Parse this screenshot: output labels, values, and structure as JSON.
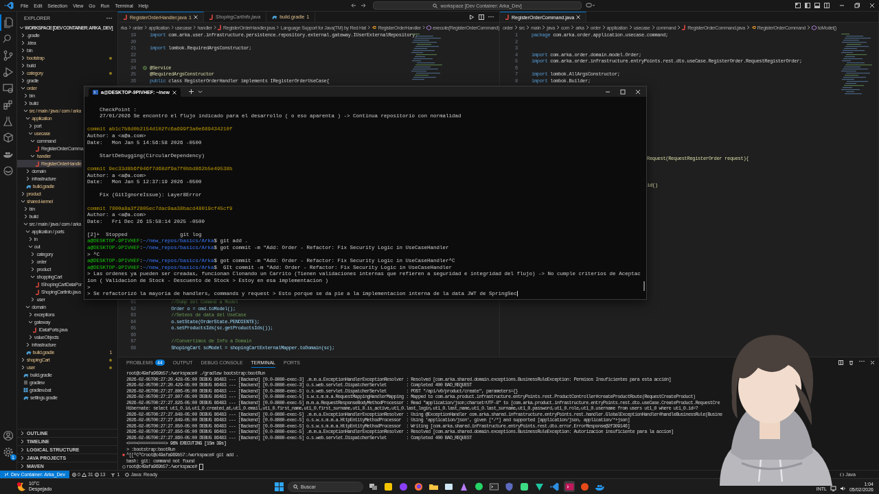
{
  "titlebar": {
    "menu": [
      "File",
      "Edit",
      "Selection",
      "View",
      "Go",
      "Run",
      "Terminal",
      "Help"
    ],
    "search": "workspace [Dev Container: Arka_Dev]"
  },
  "activity_bar": {
    "settings_badge": "1"
  },
  "sidebar": {
    "title": "EXPLORER",
    "workspace": "WORKSPACE [DEV CONTAINER: ARKA_DEV]",
    "tree": [
      {
        "label": ".gradle",
        "kind": "folder",
        "expanded": false,
        "modified": false,
        "dot": false,
        "selected": false
      },
      {
        "label": ".idea",
        "kind": "folder",
        "expanded": false,
        "modified": false,
        "dot": false,
        "selected": false
      },
      {
        "label": "bin",
        "kind": "folder",
        "expanded": false,
        "modified": false,
        "dot": false,
        "selected": false
      },
      {
        "label": "bootstrap",
        "kind": "folder",
        "expanded": false,
        "modified": true,
        "dot": true,
        "selected": false
      },
      {
        "label": "build",
        "kind": "folder",
        "expanded": false,
        "modified": false,
        "dot": false,
        "selected": false
      },
      {
        "label": "category",
        "kind": "folder",
        "expanded": false,
        "modified": true,
        "dot": true,
        "selected": false
      },
      {
        "label": "gradle",
        "kind": "folder",
        "expanded": false,
        "modified": false,
        "dot": false,
        "selected": false
      },
      {
        "label": "order",
        "kind": "folder",
        "expanded": true,
        "modified": true,
        "selected": false,
        "children": [
          {
            "label": "bin",
            "kind": "folder",
            "expanded": false,
            "modified": false,
            "selected": false
          },
          {
            "label": "build",
            "kind": "folder",
            "expanded": false,
            "modified": false,
            "selected": false
          },
          {
            "label": "src / main / java / com / arka",
            "kind": "folder",
            "expanded": true,
            "modified": true,
            "selected": false,
            "children": [
              {
                "label": "application",
                "kind": "folder",
                "expanded": true,
                "modified": true,
                "selected": false,
                "children": [
                  {
                    "label": "port",
                    "kind": "folder",
                    "expanded": false,
                    "modified": false,
                    "selected": false
                  },
                  {
                    "label": "usecase",
                    "kind": "folder",
                    "expanded": true,
                    "modified": true,
                    "selected": false,
                    "children": [
                      {
                        "label": "command",
                        "kind": "folder",
                        "expanded": true,
                        "modified": false,
                        "selected": false,
                        "children": [
                          {
                            "label": "RegisterOrderComma",
                            "kind": "java",
                            "modified": false,
                            "selected": false
                          }
                        ]
                      },
                      {
                        "label": "handler",
                        "kind": "folder",
                        "expanded": true,
                        "modified": true,
                        "selected": false,
                        "children": [
                          {
                            "label": "RegisterOrderHandle",
                            "kind": "java",
                            "modified": true,
                            "selected": true
                          }
                        ]
                      }
                    ]
                  }
                ]
              },
              {
                "label": "domain",
                "kind": "folder",
                "expanded": false,
                "modified": false,
                "selected": false
              },
              {
                "label": "infrastructure",
                "kind": "folder",
                "expanded": false,
                "modified": false,
                "selected": false
              }
            ]
          },
          {
            "label": "build.gradle",
            "kind": "gradle",
            "modified": true,
            "selected": false
          }
        ]
      },
      {
        "label": "product",
        "kind": "folder",
        "expanded": false,
        "modified": true,
        "selected": false
      },
      {
        "label": "shared-kernel",
        "kind": "folder",
        "expanded": true,
        "modified": true,
        "selected": false,
        "children": [
          {
            "label": "bin",
            "kind": "folder",
            "expanded": false,
            "modified": false,
            "selected": false
          },
          {
            "label": "build",
            "kind": "folder",
            "expanded": false,
            "modified": false,
            "selected": false
          },
          {
            "label": "src / main / java / com / arka",
            "kind": "folder",
            "expanded": true,
            "modified": false,
            "selected": false,
            "children": [
              {
                "label": "application / ports",
                "kind": "folder",
                "expanded": true,
                "modified": false,
                "selected": false,
                "children": [
                  {
                    "label": "in",
                    "kind": "folder",
                    "expanded": false,
                    "modified": false,
                    "selected": false
                  },
                  {
                    "label": "out",
                    "kind": "folder",
                    "expanded": true,
                    "modified": false,
                    "selected": false,
                    "children": [
                      {
                        "label": "category",
                        "kind": "folder",
                        "expanded": false,
                        "modified": false,
                        "selected": false
                      },
                      {
                        "label": "order",
                        "kind": "folder",
                        "expanded": false,
                        "modified": false,
                        "selected": false
                      },
                      {
                        "label": "product",
                        "kind": "folder",
                        "expanded": false,
                        "modified": false,
                        "selected": false
                      },
                      {
                        "label": "shoppingCart",
                        "kind": "folder",
                        "expanded": true,
                        "modified": false,
                        "selected": false,
                        "children": [
                          {
                            "label": "IShopingCartDataPor",
                            "kind": "java",
                            "modified": false,
                            "selected": false
                          },
                          {
                            "label": "ShopingCartInfo.java",
                            "kind": "java",
                            "modified": false,
                            "selected": false
                          }
                        ]
                      },
                      {
                        "label": "user",
                        "kind": "folder",
                        "expanded": false,
                        "modified": false,
                        "selected": false
                      }
                    ]
                  }
                ]
              },
              {
                "label": "domain",
                "kind": "folder",
                "expanded": true,
                "modified": false,
                "selected": false,
                "children": [
                  {
                    "label": "exceptions",
                    "kind": "folder",
                    "expanded": false,
                    "modified": false,
                    "selected": false
                  },
                  {
                    "label": "gateway",
                    "kind": "folder",
                    "expanded": true,
                    "modified": false,
                    "selected": false,
                    "children": [
                      {
                        "label": "IDataPorts.java",
                        "kind": "java",
                        "modified": false,
                        "selected": false
                      }
                    ]
                  },
                  {
                    "label": "valueObjects",
                    "kind": "folder",
                    "expanded": false,
                    "modified": false,
                    "selected": false
                  }
                ]
              },
              {
                "label": "infrastructure",
                "kind": "folder",
                "expanded": false,
                "modified": false,
                "selected": false
              }
            ]
          },
          {
            "label": "build.gradle",
            "kind": "gradle",
            "modified": true,
            "badge": "1",
            "selected": false
          }
        ]
      },
      {
        "label": "shopingCart",
        "kind": "folder",
        "expanded": false,
        "modified": true,
        "dot": true,
        "selected": false
      },
      {
        "label": "user",
        "kind": "folder",
        "expanded": false,
        "modified": true,
        "dot": true,
        "selected": false
      },
      {
        "label": "build.gradle",
        "kind": "gradle",
        "modified": false,
        "dot": false,
        "selected": false
      },
      {
        "label": "gradlew",
        "kind": "file",
        "modified": false,
        "dot": false,
        "selected": false
      },
      {
        "label": "gradlew.bat",
        "kind": "bat",
        "modified": false,
        "dot": false,
        "selected": false
      },
      {
        "label": "settings.gradle",
        "kind": "gradle",
        "modified": false,
        "dot": false,
        "selected": false
      }
    ],
    "sections": [
      "OUTLINE",
      "TIMELINE",
      "LOGICAL STRUCTURE",
      "JAVA PROJECTS",
      "MAVEN"
    ]
  },
  "editor_left": {
    "tabs": [
      {
        "label": "RegisterOrderHandler.java",
        "badge": "1",
        "kind": "java",
        "selected": true,
        "preview": false,
        "modified": true
      },
      {
        "label": "ShopingCartInfo.java",
        "kind": "java",
        "selected": false,
        "preview": true,
        "modified": false
      },
      {
        "label": "build.gradle",
        "badge": "1",
        "kind": "gradle",
        "selected": false,
        "preview": false,
        "modified": true
      }
    ],
    "breadcrumbs": [
      {
        "text": "rka",
        "kind": "folder"
      },
      {
        "text": "order",
        "kind": "folder"
      },
      {
        "text": "application",
        "kind": "folder"
      },
      {
        "text": "usecase",
        "kind": "folder"
      },
      {
        "text": "handler",
        "kind": "folder"
      },
      {
        "text": "RegisterOrderHandler.java",
        "kind": "java"
      },
      {
        "text": "Language Support for Java(TM) by Red Hat",
        "kind": "folder"
      },
      {
        "text": "RegisterOrderHandler",
        "kind": "class"
      },
      {
        "text": "execute(RegisterOrderCommand)",
        "kind": "method"
      }
    ],
    "lines": [
      {
        "n": "19",
        "kind": "import",
        "text": "import com.arka.user.infrastructure.persistence.repository.external.gateway.IUserExternalRepository;"
      },
      {
        "n": "20",
        "kind": "blank"
      },
      {
        "n": "21",
        "kind": "import",
        "text": "import lombok.RequiredArgsConstructor;"
      },
      {
        "n": "22",
        "kind": "blank"
      },
      {
        "n": "23",
        "kind": "blank"
      },
      {
        "n": "24",
        "kind": "annotation",
        "text": "@Service",
        "gutter": true
      },
      {
        "n": "25",
        "kind": "annotation",
        "text": "@RequiredArgsConstructor"
      },
      {
        "n": "26",
        "kind": "import",
        "text": "public class RegisterOrderHandler implements IRegisterOrderUseCase{"
      }
    ],
    "lines_lower": [
      {
        "n": "61",
        "kind": "comment",
        "text": "        //Dump del Comand a Model"
      },
      {
        "n": "62",
        "kind": "code",
        "text": "        Order o = cmd.toModel();"
      },
      {
        "n": "63",
        "kind": "comment",
        "text": "        //Seteos de data del UseCase"
      },
      {
        "n": "64",
        "kind": "code",
        "text": "        o.setState(OrderState.PENDIENTE);"
      },
      {
        "n": "65",
        "kind": "code",
        "text": "        o.setProductsIds(sc.getProductsIds());"
      },
      {
        "n": "66",
        "kind": "blank"
      },
      {
        "n": "67",
        "kind": "comment",
        "text": "        //Convertimos de Info a Domain"
      },
      {
        "n": "68",
        "kind": "code",
        "text": "        ShopingCart scModel = shopingCartExternalMapper.toDomain(sc);"
      }
    ]
  },
  "editor_right": {
    "tabs": [
      {
        "label": "RegisterOrderCommand.java",
        "kind": "java",
        "selected": true,
        "preview": false,
        "modified": false
      }
    ],
    "breadcrumbs": [
      {
        "text": "order",
        "kind": "folder"
      },
      {
        "text": "src",
        "kind": "folder"
      },
      {
        "text": "main",
        "kind": "folder"
      },
      {
        "text": "java",
        "kind": "folder"
      },
      {
        "text": "com",
        "kind": "folder"
      },
      {
        "text": "arka",
        "kind": "folder"
      },
      {
        "text": "order",
        "kind": "folder"
      },
      {
        "text": "application",
        "kind": "folder"
      },
      {
        "text": "usecase",
        "kind": "folder"
      },
      {
        "text": "command",
        "kind": "folder"
      },
      {
        "text": "RegisterOrderCommand.java",
        "kind": "java"
      },
      {
        "text": "RegisterOrderCommand",
        "kind": "class"
      },
      {
        "text": "toModel()",
        "kind": "method"
      }
    ],
    "lines": [
      {
        "n": "1",
        "kind": "import",
        "text": "package com.arka.order.application.usecase.command;"
      },
      {
        "n": "2",
        "kind": "blank"
      },
      {
        "n": "3",
        "kind": "blank"
      },
      {
        "n": "4",
        "kind": "import",
        "text": "import com.arka.order.domain.model.Order;"
      },
      {
        "n": "5",
        "kind": "import",
        "text": "import com.arka.order.infrastructure.entryPoints.rest.dto.useCase.RegisterOrder.RequestRegisterOrder;"
      },
      {
        "n": "6",
        "kind": "blank"
      },
      {
        "n": "7",
        "kind": "import",
        "text": "import lombok.AllArgsConstructor;"
      },
      {
        "n": "8",
        "kind": "import",
        "text": "import lombok.Builder;"
      }
    ],
    "fragments": [
      "Request(RequestRegisterOrder request){",
      "id()"
    ]
  },
  "terminal_window": {
    "title": "a@DESKTOP-9PIVHEF: ~/new",
    "lines": [
      {
        "kind": "blank"
      },
      {
        "kind": "text",
        "text": "    CheckPoint :"
      },
      {
        "kind": "text",
        "text": "    27/01/2026 Se encontró el flujo indicado para el desarrollo ( o eso aparenta ) -> Continua repositorio con normalidad"
      },
      {
        "kind": "blank"
      },
      {
        "kind": "commit",
        "text": "commit ab1c7b8d0b2154d102fc6a699f3a0e689434210f"
      },
      {
        "kind": "text",
        "text": "Author: a <a@a.com>"
      },
      {
        "kind": "text",
        "text": "Date:   Mon Jan 5 14:56:58 2026 -0500"
      },
      {
        "kind": "blank"
      },
      {
        "kind": "text",
        "text": "    StartDebugging(CircularDependency)"
      },
      {
        "kind": "blank"
      },
      {
        "kind": "commit",
        "text": "commit 9ec33d8b6f046f7d68df9a7f0bbd862b5e49538b"
      },
      {
        "kind": "text",
        "text": "Author: a <a@a.com>"
      },
      {
        "kind": "text",
        "text": "Date:   Mon Jan 5 12:37:19 2026 -0500"
      },
      {
        "kind": "blank"
      },
      {
        "kind": "text",
        "text": "    Fix (GitIgnoreIssue): Layer8Error"
      },
      {
        "kind": "blank"
      },
      {
        "kind": "commit",
        "text": "commit 7800a8a3f2805ec7dac9aa38bacd48019cf45cf9"
      },
      {
        "kind": "text",
        "text": "Author: a <a@a.com>"
      },
      {
        "kind": "text",
        "text": "Date:   Fri Dec 26 15:58:14 2025 -0500"
      },
      {
        "kind": "blank"
      },
      {
        "kind": "text",
        "text": "[2]+  Stopped                 git log"
      },
      {
        "kind": "prompt",
        "user": "a@DESKTOP-9PIVHEF",
        "sep": ":",
        "path": "~/new_repos/basics/Arka",
        "command": "$ git add ."
      },
      {
        "kind": "prompt",
        "user": "a@DESKTOP-9PIVHEF",
        "sep": ":",
        "path": "~/new_repos/basics/Arka",
        "command": "$ got commit -m \"Add: Order - Refactor: Fix Security Logic in UseCaseHandler"
      },
      {
        "kind": "text",
        "text": "> ^C"
      },
      {
        "kind": "prompt",
        "user": "a@DESKTOP-9PIVHEF",
        "sep": ":",
        "path": "~/new_repos/basics/Arka",
        "command": "$ got commit -m \"Add: Order - Refactor: Fix Security Logic in UseCaseHandler^C"
      },
      {
        "kind": "prompt",
        "user": "a@DESKTOP-9PIVHEF",
        "sep": ":",
        "path": "~/new_repos/basics/Arka",
        "command": "$  GIt commit -m \"Add: Order - Refactor: Fix Security Logic in UseCaseHandler"
      },
      {
        "kind": "text",
        "text": "> Las ordenes ya pueden ser creadas, funcionan Clonando un Carrito (Tienen validaciones internas que refieren a seguridad e integridad del flujo) -> No cumple criterios de Aceptac"
      },
      {
        "kind": "text",
        "text": "ion ( Validacion de Stock - Descuento de Stock > Estoy en esa implementacion )"
      },
      {
        "kind": "text",
        "text": ">"
      },
      {
        "kind": "input",
        "text": "> Se refactorizó la mayoria de handlers, commands y request > Esto porque se da pie a la implementacion interna de la data JWT de SpringSec"
      }
    ]
  },
  "panel": {
    "tabs": [
      {
        "label": "PROBLEMS",
        "badge": "44",
        "selected": false
      },
      {
        "label": "OUTPUT",
        "selected": false
      },
      {
        "label": "DEBUG CONSOLE",
        "selected": false
      },
      {
        "label": "TERMINAL",
        "selected": true
      },
      {
        "label": "PORTS",
        "selected": false
      }
    ],
    "lines": [
      {
        "kind": "plain",
        "text": "root@c49afa969b57:/workspace# ./gradlew bootstrap:bootRun"
      },
      {
        "kind": "plain",
        "text": "2026-02-05T00:27:20.428-05:00 DEBUG 86483 --- [Backend] [0.0-8080-exec-3] .m.m.a.ExceptionHandlerExceptionResolver : Resolved [com.arka.shared.domain.exceptions.BusinessRuleException: Permisos Insuficientes para esta acción]"
      },
      {
        "kind": "plain",
        "text": "2026-02-05T00:27:20.429-05:00 DEBUG 86483 --- [Backend] [0.0-8080-exec-3] o.s.web.servlet.DispatcherServlet        : Completed 400 BAD_REQUEST"
      },
      {
        "kind": "plain",
        "text": "2026-02-05T00:27:27.806-05:00 DEBUG 86483 --- [Backend] [0.0-8080-exec-5] o.s.web.servlet.DispatcherServlet        : POST \"/api/v0/product/create\", parameters={}"
      },
      {
        "kind": "plain",
        "text": "2026-02-05T00:27:27.807-05:00 DEBUG 86483 --- [Backend] [0.0-8080-exec-5] s.w.s.m.m.a.RequestMappingHandlerMapping : Mapped to com.arka.product.infrastructure.entryPoints.rest.ProductController#createProductRoute(RequestCreateProduct)"
      },
      {
        "kind": "plain",
        "text": "2026-02-05T00:27:27.826-05:00 DEBUG 86483 --- [Backend] [0.0-8080-exec-5] m.m.a.RequestResponseBodyMethodProcessor : Read \"application/json;charset=UTF-8\" to [com.arka.product.infrastructure.entryPoints.rest.dto.useCase.CreateProduct.RequestCre"
      },
      {
        "kind": "plain",
        "text": "Hibernate: select ut1_0.id,ut1_0.created_at,ut1_0.email,ut1_0.first_name,ut1_0.first_surname,ut1_0.is_active,ut1_0.last_login,ut1_0.last_name,ut1_0.last_surname,ut1_0.password,ut1_0.role,ut1_0.username from users ut1_0 where ut1_0.id=?"
      },
      {
        "kind": "plain",
        "text": "2026-02-05T00:27:27.848-05:00 DEBUG 86483 --- [Backend] [0.0-8080-exec-5] .m.m.a.ExceptionHandlerExceptionResolver : Using @ExceptionHandler com.arka.shared.infrastructure.entryPoints.rest.handler.GlobalExceptionHandler#handleBusinessRule(Busine"
      },
      {
        "kind": "plain",
        "text": "2026-02-05T00:27:27.849-05:00 DEBUG 86483 --- [Backend] [0.0-8080-exec-5] o.s.w.s.m.m.a.HttpEntityMethodProcessor  : Using 'application/json', given [*/*] and supported [application/json, application/*+json]"
      },
      {
        "kind": "plain",
        "text": "2026-02-05T00:27:27.850-05:00 DEBUG 86483 --- [Backend] [0.0-8080-exec-5] o.s.w.s.m.m.a.HttpEntityMethodProcessor  : Writing [com.arka.shared.infrastructure.entryPoints.rest.dto.error.ErrorResponse@2f309146]"
      },
      {
        "kind": "plain",
        "text": "2026-02-05T00:27:27.856-05:00 DEBUG 86483 --- [Backend] [0.0-8080-exec-5] .m.m.a.ExceptionHandlerExceptionResolver : Resolved [com.arka.shared.domain.exceptions.BusinessRuleException: Autorizacion insuficiente para la accion]"
      },
      {
        "kind": "plain",
        "text": "2026-02-05T00:27:27.860-05:00 DEBUG 86483 --- [Backend] [0.0-8080-exec-5] o.s.web.servlet.DispatcherServlet        : Completed 400 BAD_REQUEST"
      },
      {
        "kind": "progress",
        "text": "<===<===========> 96% EXECUTING [15m 39s]"
      },
      {
        "kind": "plain",
        "text": "> :bootstrap:bootRun"
      },
      {
        "kind": "error",
        "text": "^[[^C^Croot@c49afa969b57:/workspace# git add ."
      },
      {
        "kind": "plain",
        "text": "bash: git: command not found"
      },
      {
        "kind": "prompt",
        "text": "root@c49afa969b57:/workspace#"
      }
    ]
  },
  "status_bar": {
    "remote": "Dev Container: Arka_Dev",
    "errors": "0",
    "warnings": "31",
    "infos": "13",
    "ports": "1",
    "java": "Java: Ready",
    "right": "Java"
  },
  "taskbar": {
    "temperature": "10°C",
    "weather": "Despejado",
    "search_placeholder": "Buscar",
    "language": "INTL",
    "time": "1:04",
    "date": "05/02/2026"
  }
}
